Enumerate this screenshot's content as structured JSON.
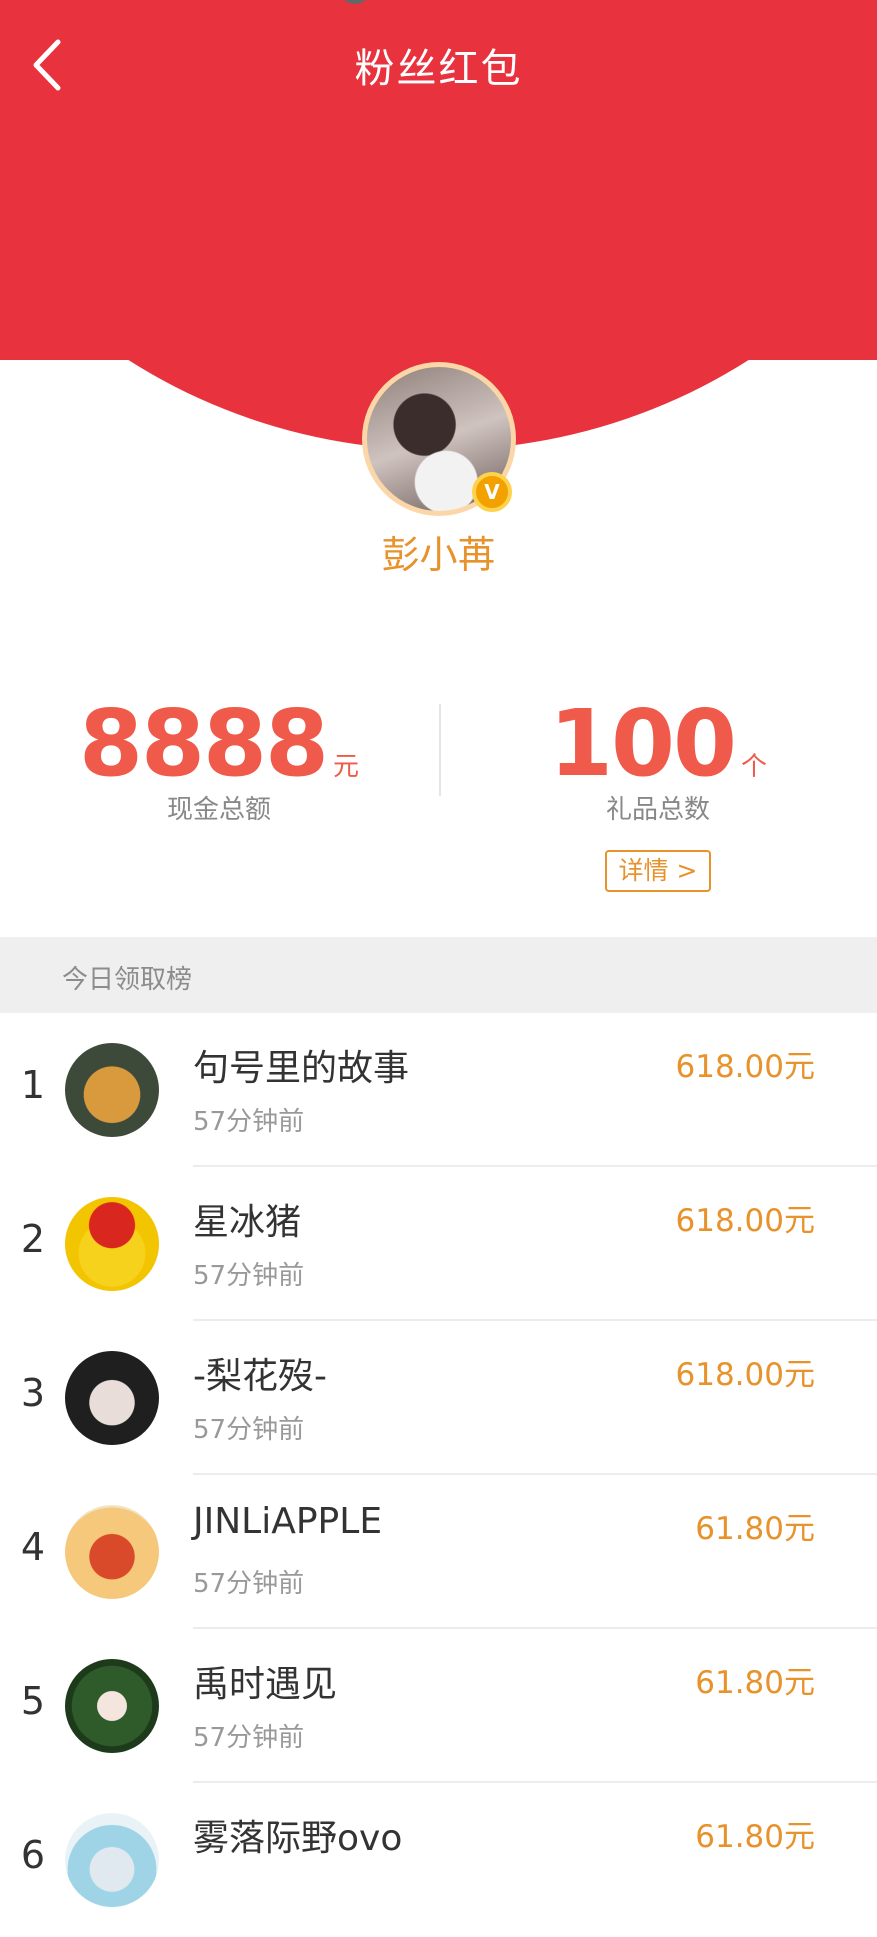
{
  "header": {
    "title": "粉丝红包",
    "back_icon": "chevron-left-icon",
    "background_color": "#e8333f"
  },
  "profile": {
    "name": "彭小苒",
    "verified_badge": "V"
  },
  "stats": {
    "cash": {
      "value": "8888",
      "unit": "元",
      "label": "现金总额"
    },
    "gifts": {
      "value": "100",
      "unit": "个",
      "label": "礼品总数"
    },
    "detail_button": "详情 >"
  },
  "leaderboard": {
    "title": "今日领取榜",
    "rows": [
      {
        "rank": "1",
        "name": "句号里的故事",
        "time": "57分钟前",
        "amount": "618.00元"
      },
      {
        "rank": "2",
        "name": "星冰猪",
        "time": "57分钟前",
        "amount": "618.00元"
      },
      {
        "rank": "3",
        "name": "-梨花歿-",
        "time": "57分钟前",
        "amount": "618.00元"
      },
      {
        "rank": "4",
        "name": "JINLiAPPLE",
        "time": "57分钟前",
        "amount": "61.80元"
      },
      {
        "rank": "5",
        "name": "禹时遇见",
        "time": "57分钟前",
        "amount": "61.80元"
      },
      {
        "rank": "6",
        "name": "雾落际野ovo",
        "time": "",
        "amount": "61.80元"
      }
    ]
  },
  "colors": {
    "accent_orange": "#e8922c",
    "stat_red": "#f05a4a"
  }
}
